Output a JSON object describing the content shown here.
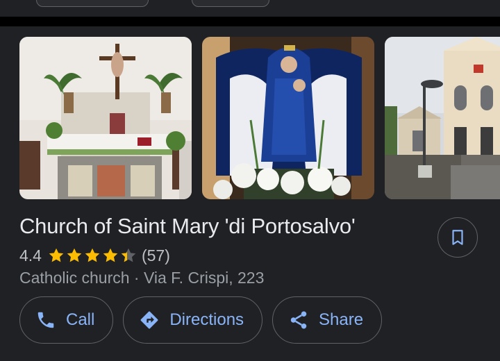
{
  "place": {
    "name": "Church of Saint Mary 'di Portosalvo'",
    "rating": "4.4",
    "stars": 4.4,
    "review_count": "(57)",
    "category_address": "Catholic church · Via F. Crispi, 223"
  },
  "photos": [
    {
      "subject": "church-altar-interior"
    },
    {
      "subject": "madonna-statue-with-flowers"
    },
    {
      "subject": "church-exterior-facade"
    }
  ],
  "actions": {
    "call_label": "Call",
    "directions_label": "Directions",
    "share_label": "Share"
  },
  "icons": {
    "call": "phone-icon",
    "directions": "directions-icon",
    "share": "share-icon",
    "save": "bookmark-icon",
    "star": "star-icon"
  },
  "colors": {
    "background": "#202124",
    "accent": "#8ab4f8",
    "star": "#fbbc04",
    "primary_text": "#e8eaed",
    "secondary_text": "#9aa0a6",
    "outline": "#5f6368"
  }
}
